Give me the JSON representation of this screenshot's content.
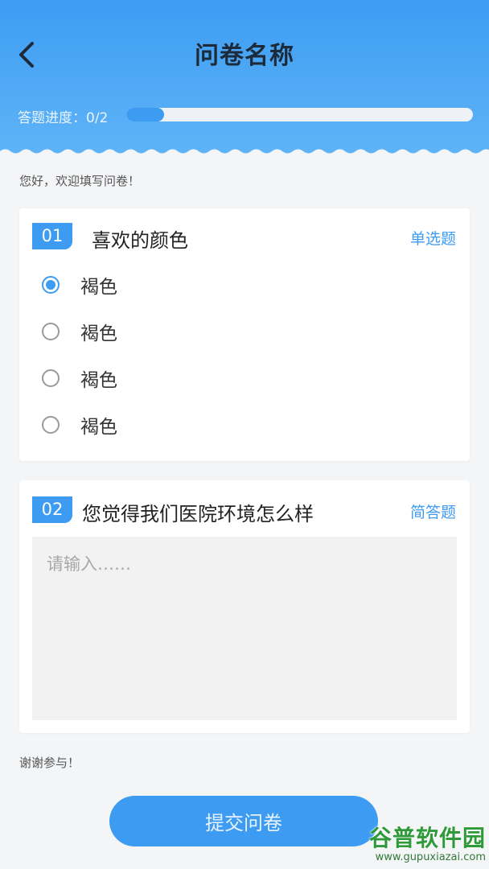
{
  "header": {
    "title": "问卷名称",
    "progress_label": "答题进度：0/2",
    "progress_fraction": 0.11
  },
  "greeting": "您好，欢迎填写问卷！",
  "questions": [
    {
      "number": "01",
      "title": "喜欢的颜色",
      "type": "单选题",
      "options": [
        "褐色",
        "褐色",
        "褐色",
        "褐色"
      ],
      "selected_index": 0
    },
    {
      "number": "02",
      "title": "您觉得我们医院环境怎么样",
      "type": "简答题",
      "placeholder": "请输入……",
      "value": ""
    }
  ],
  "footer": {
    "thanks": "谢谢参与！",
    "submit_label": "提交问卷"
  },
  "watermark": {
    "logo": "谷普软件园",
    "url": "www.gupuxiazai.com"
  },
  "colors": {
    "accent": "#3d9cf2",
    "header_top": "#3d9cf2",
    "header_bottom": "#5fb4f7"
  },
  "icons": {
    "back": "chevron-left-icon"
  }
}
